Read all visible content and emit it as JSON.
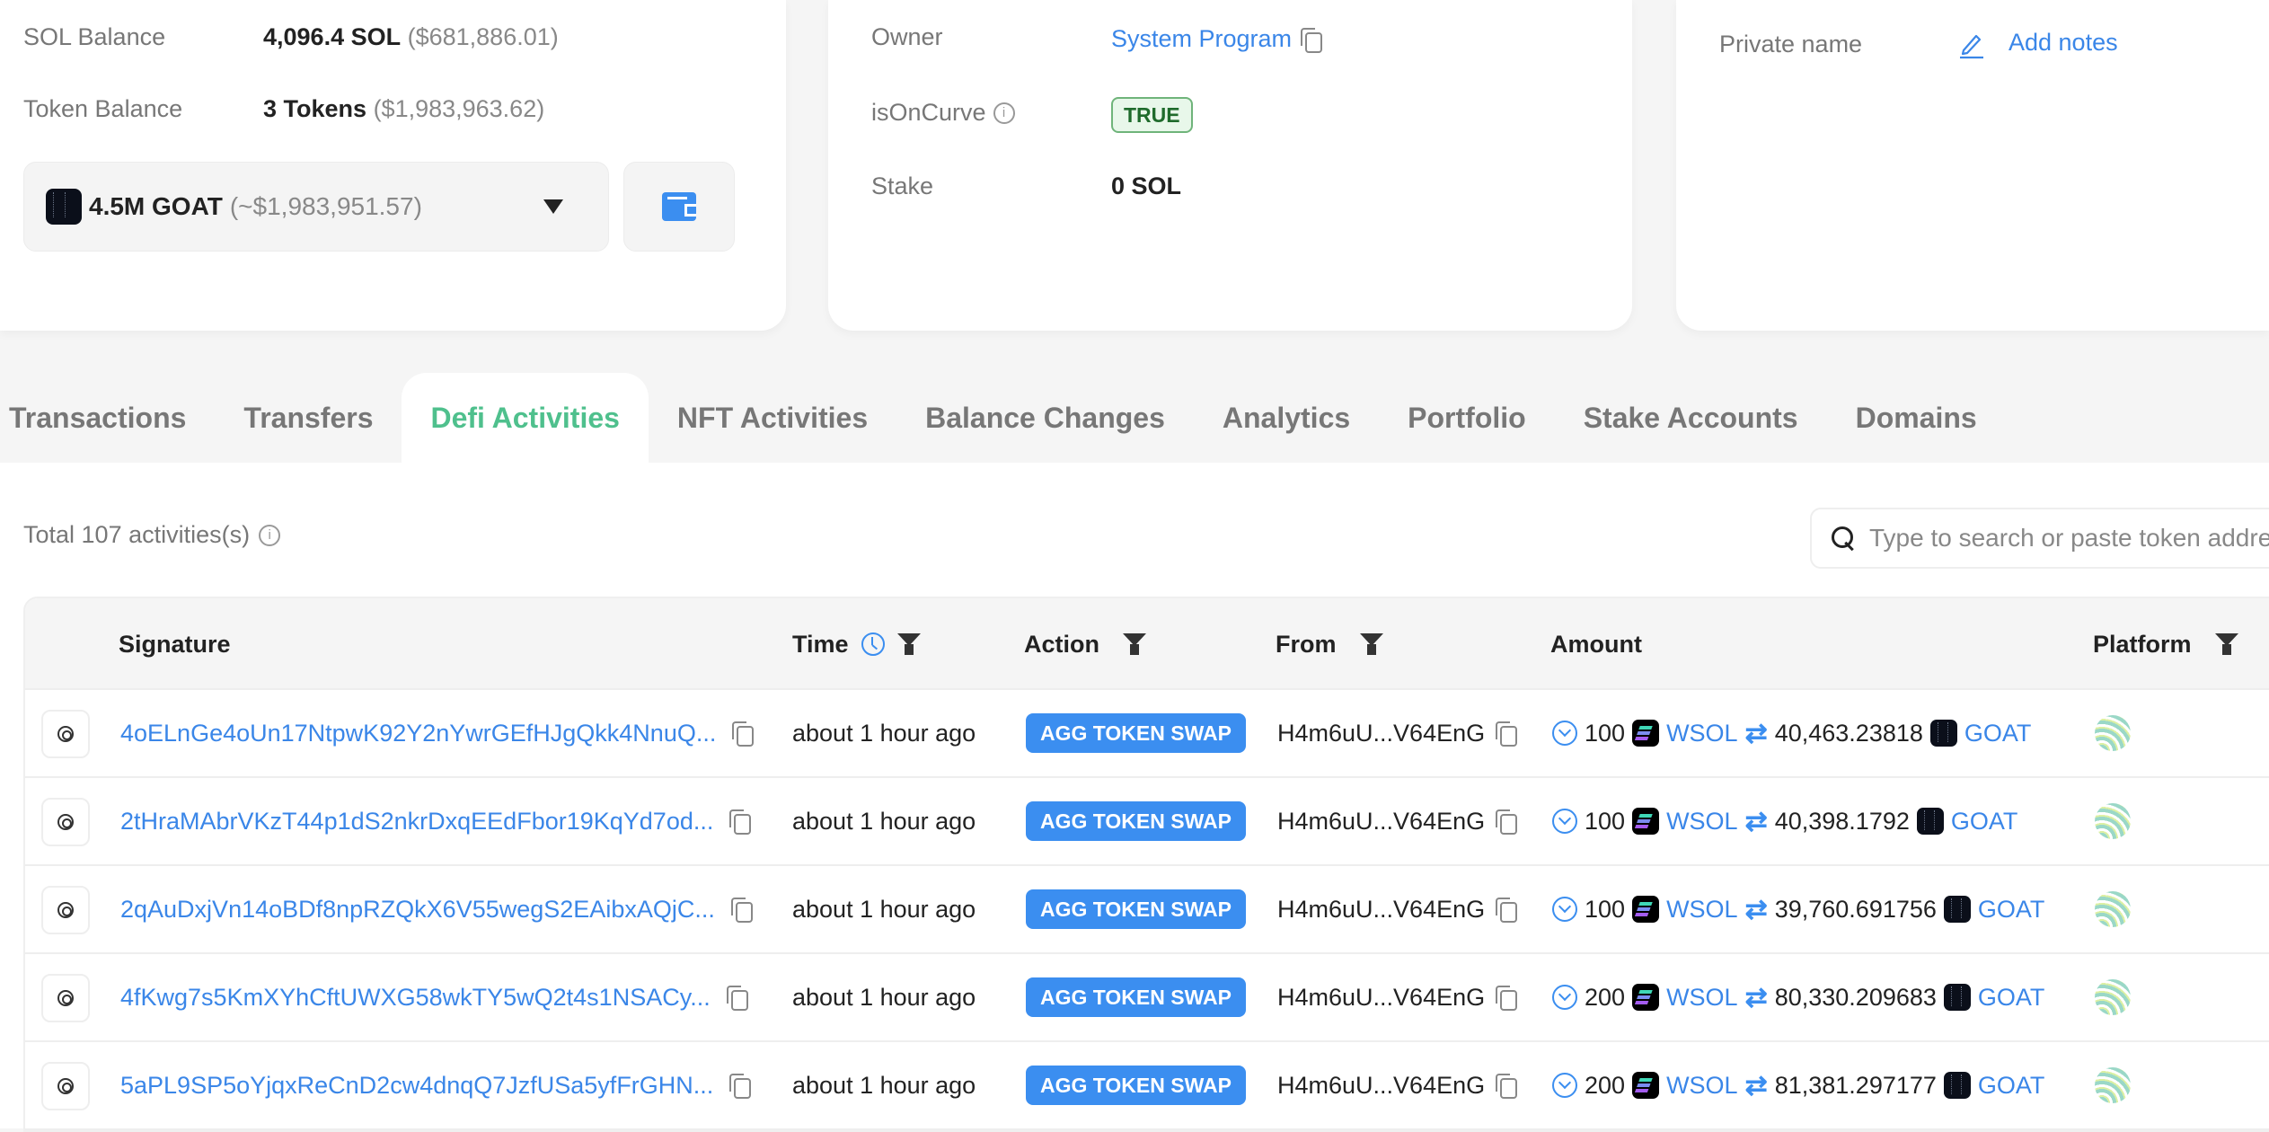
{
  "overview": {
    "sol_balance_label": "SOL Balance",
    "sol_balance_value": "4,096.4 SOL",
    "sol_balance_usd": "($681,886.01)",
    "token_balance_label": "Token Balance",
    "token_balance_value": "3 Tokens",
    "token_balance_usd": "($1,983,963.62)",
    "token_select": {
      "selected": "4.5M GOAT",
      "selected_usd": "(~$1,983,951.57)"
    }
  },
  "details": {
    "owner_label": "Owner",
    "owner_value": "System Program",
    "is_on_curve_label": "isOnCurve",
    "is_on_curve_value": "TRUE",
    "stake_label": "Stake",
    "stake_value": "0 SOL"
  },
  "notes": {
    "private_name_label": "Private name",
    "add_notes_label": "Add notes"
  },
  "tabs": [
    {
      "label": "Transactions",
      "active": false
    },
    {
      "label": "Transfers",
      "active": false
    },
    {
      "label": "Defi Activities",
      "active": true
    },
    {
      "label": "NFT Activities",
      "active": false
    },
    {
      "label": "Balance Changes",
      "active": false
    },
    {
      "label": "Analytics",
      "active": false
    },
    {
      "label": "Portfolio",
      "active": false
    },
    {
      "label": "Stake Accounts",
      "active": false
    },
    {
      "label": "Domains",
      "active": false
    }
  ],
  "activities": {
    "total_text": "Total 107 activities(s)",
    "search_placeholder": "Type to search or paste token address",
    "columns": {
      "signature": "Signature",
      "time": "Time",
      "action": "Action",
      "from": "From",
      "amount": "Amount",
      "platform": "Platform"
    },
    "rows": [
      {
        "signature": "4oELnGe4oUn17NtpwK92Y2nYwrGEfHJgQkk4NnuQ...",
        "time": "about 1 hour ago",
        "action": "AGG TOKEN SWAP",
        "from": "H4m6uU...V64EnG",
        "amount_in": "100",
        "token_in": "WSOL",
        "amount_out": "40,463.23818",
        "token_out": "GOAT"
      },
      {
        "signature": "2tHraMAbrVKzT44p1dS2nkrDxqEEdFbor19KqYd7od...",
        "time": "about 1 hour ago",
        "action": "AGG TOKEN SWAP",
        "from": "H4m6uU...V64EnG",
        "amount_in": "100",
        "token_in": "WSOL",
        "amount_out": "40,398.1792",
        "token_out": "GOAT"
      },
      {
        "signature": "2qAuDxjVn14oBDf8npRZQkX6V55wegS2EAibxAQjC...",
        "time": "about 1 hour ago",
        "action": "AGG TOKEN SWAP",
        "from": "H4m6uU...V64EnG",
        "amount_in": "100",
        "token_in": "WSOL",
        "amount_out": "39,760.691756",
        "token_out": "GOAT"
      },
      {
        "signature": "4fKwg7s5KmXYhCftUWXG58wkTY5wQ2t4s1NSACy...",
        "time": "about 1 hour ago",
        "action": "AGG TOKEN SWAP",
        "from": "H4m6uU...V64EnG",
        "amount_in": "200",
        "token_in": "WSOL",
        "amount_out": "80,330.209683",
        "token_out": "GOAT"
      },
      {
        "signature": "5aPL9SP5oYjqxReCnD2cw4dnqQ7JzfUSa5yfFrGHN...",
        "time": "about 1 hour ago",
        "action": "AGG TOKEN SWAP",
        "from": "H4m6uU...V64EnG",
        "amount_in": "200",
        "token_in": "WSOL",
        "amount_out": "81,381.297177",
        "token_out": "GOAT"
      }
    ]
  },
  "colors": {
    "accent_blue": "#3b8ef0",
    "active_tab_green": "#4fc08d",
    "true_badge_green": "#1f6b2c"
  }
}
